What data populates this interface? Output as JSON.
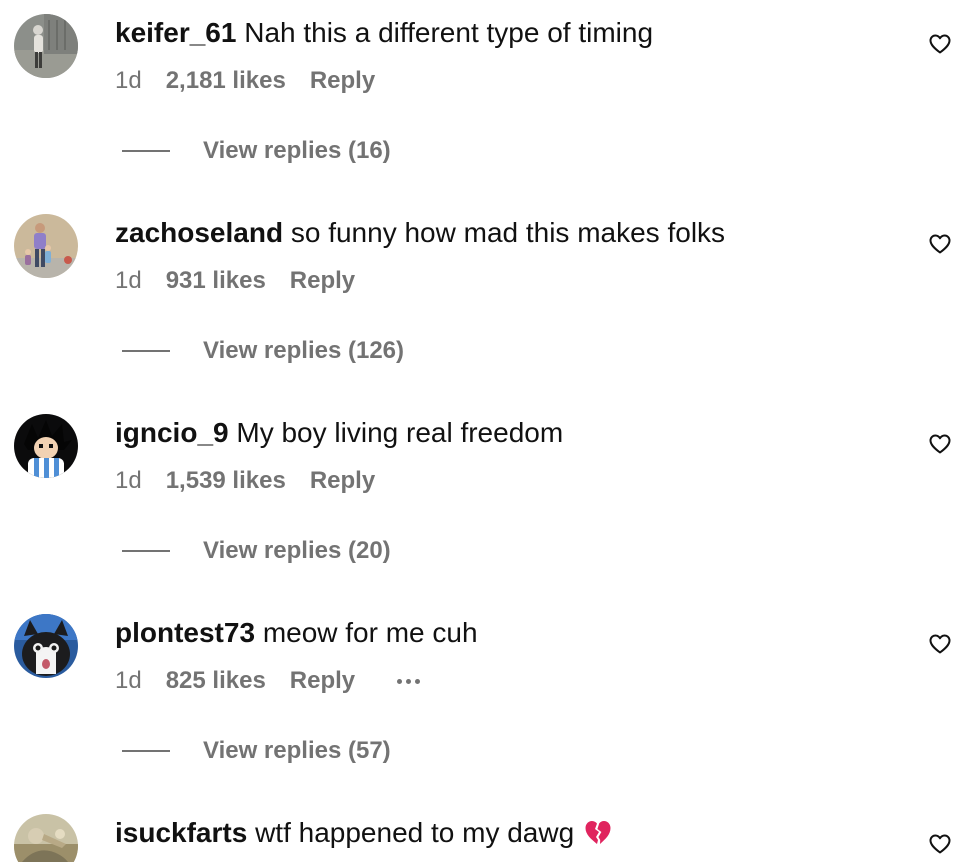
{
  "comments": [
    {
      "username": "keifer_61",
      "text": "Nah this a different type of timing",
      "time": "1d",
      "likes": "2,181 likes",
      "reply_label": "Reply",
      "view_replies": "View replies (16)"
    },
    {
      "username": "zachoseland",
      "text": "so funny how mad this makes folks",
      "time": "1d",
      "likes": "931 likes",
      "reply_label": "Reply",
      "view_replies": "View replies (126)"
    },
    {
      "username": "igncio_9",
      "text": "My boy living real freedom",
      "time": "1d",
      "likes": "1,539 likes",
      "reply_label": "Reply",
      "view_replies": "View replies (20)"
    },
    {
      "username": "plontest73",
      "text": "meow for me cuh",
      "time": "1d",
      "likes": "825 likes",
      "reply_label": "Reply",
      "view_replies": "View replies (57)",
      "more_options_icon": "ellipsis-icon"
    },
    {
      "username": "isuckfarts",
      "text": "wtf happened to my dawg",
      "emoji": "broken-heart-icon"
    }
  ],
  "icons": {
    "like": "heart-outline-icon"
  },
  "colors": {
    "text_primary": "#111111",
    "text_secondary": "#737373",
    "background": "#ffffff",
    "broken_heart": "#e0245e"
  }
}
